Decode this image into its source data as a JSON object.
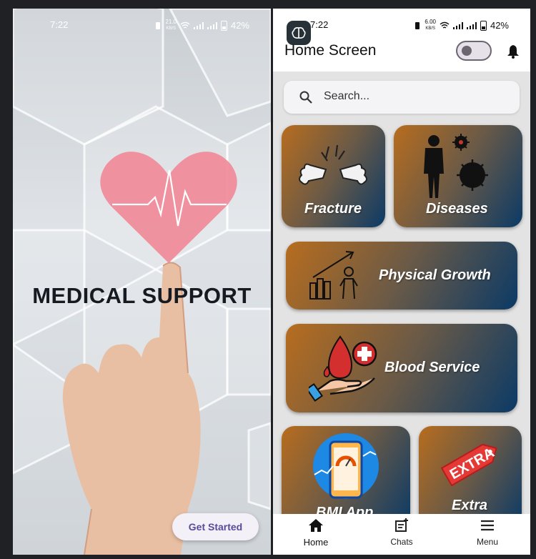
{
  "splash": {
    "status": {
      "time": "7:22",
      "speed": "21.0",
      "speed_unit": "KB/S",
      "battery": "42%"
    },
    "title": "MEDICAL SUPPORT",
    "get_started_label": "Get Started"
  },
  "home": {
    "status": {
      "time": "7:22",
      "speed": "6.00",
      "speed_unit": "KB/S",
      "battery": "42%"
    },
    "title": "Home Screen",
    "search": {
      "placeholder": "Search..."
    },
    "cards": [
      {
        "label": "Fracture",
        "icon": "broken-bone-icon"
      },
      {
        "label": "Diseases",
        "icon": "person-virus-icon"
      },
      {
        "label": "Physical Growth",
        "icon": "growth-chart-icon"
      },
      {
        "label": "Blood Service",
        "icon": "blood-drop-hand-icon"
      },
      {
        "label": "BMI App",
        "icon": "bmi-phone-icon"
      },
      {
        "label": "Extra",
        "icon": "extra-tag-icon"
      }
    ],
    "nav": [
      {
        "label": "Home",
        "icon": "home-icon"
      },
      {
        "label": "Chats",
        "icon": "chats-icon"
      },
      {
        "label": "Menu",
        "icon": "menu-icon"
      }
    ]
  },
  "colors": {
    "card_gradient_start": "#b86d1e",
    "card_gradient_end": "#0b3a66",
    "heart": "#f08a98",
    "button_text": "#5a4a9a"
  }
}
